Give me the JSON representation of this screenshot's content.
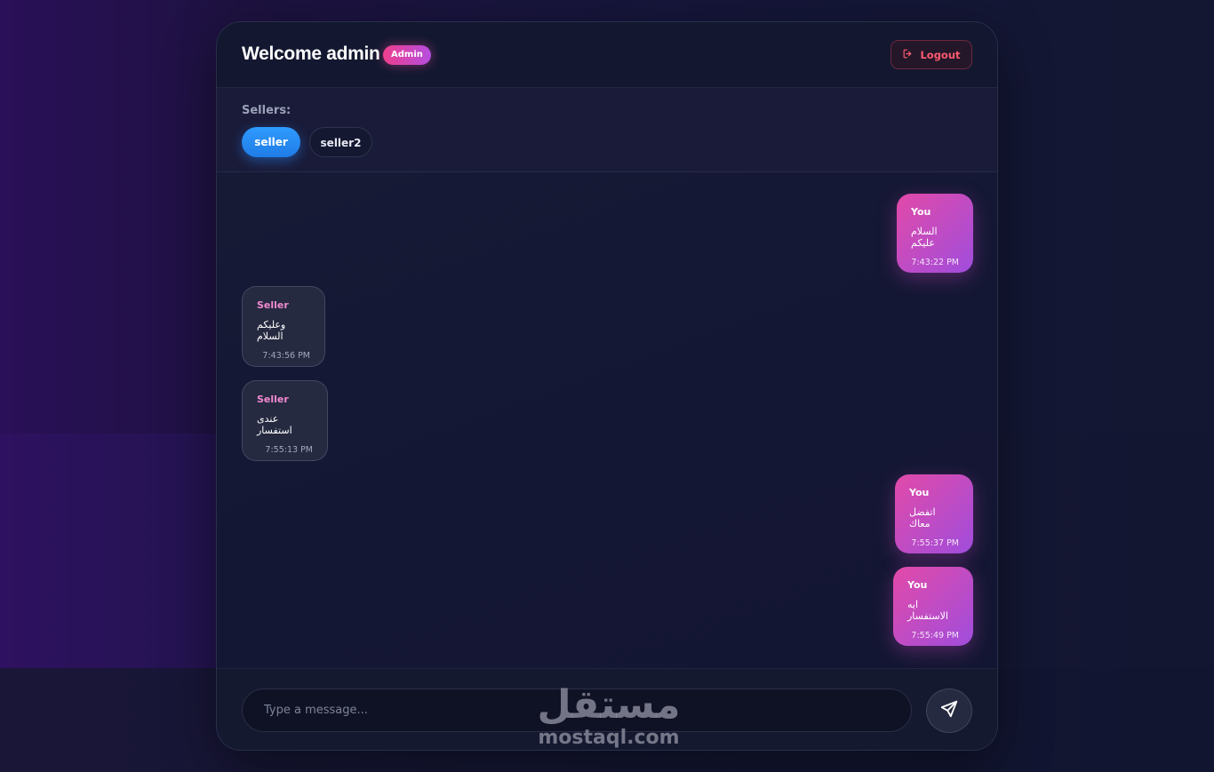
{
  "header": {
    "welcome": "Welcome admin",
    "role_badge": "Admin",
    "logout_label": "Logout"
  },
  "sellers": {
    "label": "Sellers:",
    "items": [
      {
        "name": "seller",
        "active": true
      },
      {
        "name": "seller2",
        "active": false
      }
    ]
  },
  "messages": [
    {
      "from": "You",
      "text": "السلام عليكم",
      "time": "7:43:22 PM",
      "side": "right"
    },
    {
      "from": "Seller",
      "text": "وعليكم السلام",
      "time": "7:43:56 PM",
      "side": "left"
    },
    {
      "from": "Seller",
      "text": "عندى استفسار",
      "time": "7:55:13 PM",
      "side": "left"
    },
    {
      "from": "You",
      "text": "اتفضل معاك",
      "time": "7:55:37 PM",
      "side": "right"
    },
    {
      "from": "You",
      "text": "ايه الاستفسار",
      "time": "7:55:49 PM",
      "side": "right"
    }
  ],
  "composer": {
    "placeholder": "Type a message..."
  },
  "watermark": {
    "arabic": "مستقل",
    "latin": "mostaql.com"
  },
  "colors": {
    "accent_pink": "#e24aa8",
    "accent_purple": "#a04ddd",
    "active_blue": "#2f9bff",
    "logout_red": "#ff5a6e"
  }
}
